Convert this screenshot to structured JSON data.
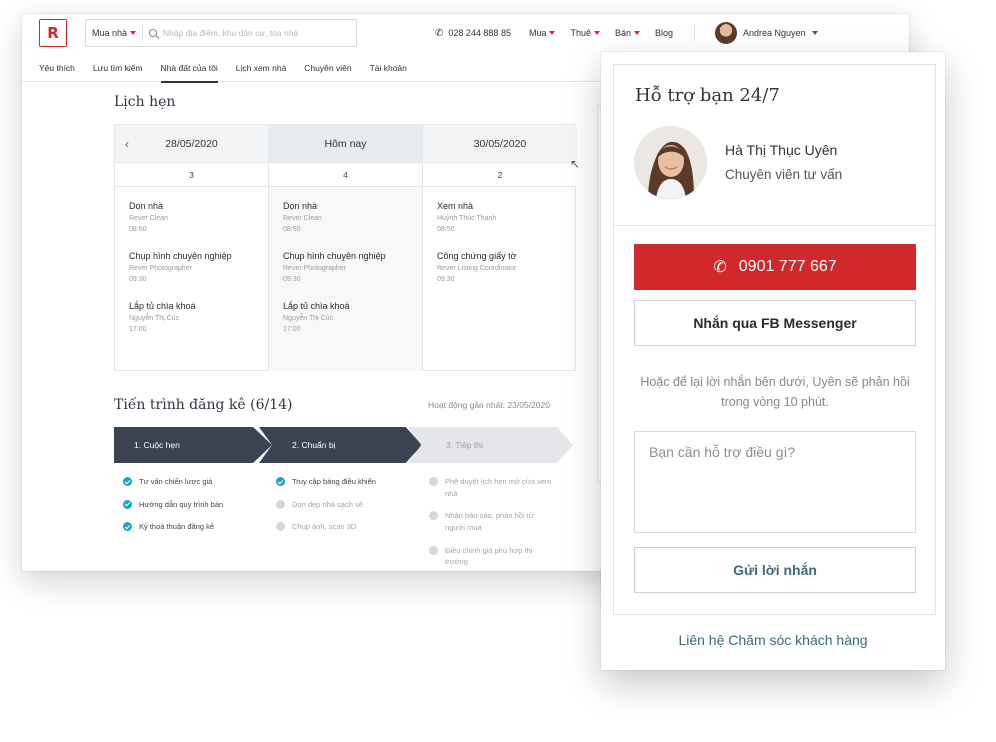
{
  "header": {
    "logo_letter": "R",
    "search_mode": "Mua nhà",
    "search_placeholder": "Nhập địa điểm, khu dân cư, tòa nhà",
    "phone": "028 244 888 85",
    "menus": [
      "Mua",
      "Thuê",
      "Bán"
    ],
    "blog": "Blog",
    "user_name": "Andrea Nguyen"
  },
  "tabs": [
    "Yêu thích",
    "Lưu tìm kiếm",
    "Nhà đất của tôi",
    "Lịch xem nhà",
    "Chuyên viên",
    "Tài khoản"
  ],
  "active_tab": "Nhà đất của tôi",
  "schedule": {
    "title": "Lịch hẹn",
    "days": [
      {
        "label": "28/05/2020",
        "count": "3",
        "items": [
          {
            "title": "Dọn nhà",
            "who": "Rever Clean",
            "time": "08:50"
          },
          {
            "title": "Chụp hình chuyên nghiệp",
            "who": "Rever Photographer",
            "time": "09:30"
          },
          {
            "title": "Lắp tủ chìa khoá",
            "who": "Nguyễn Thị Cúc",
            "time": "17:00"
          }
        ]
      },
      {
        "label": "Hôm nay",
        "count": "4",
        "items": [
          {
            "title": "Dọn nhà",
            "who": "Rever Clean",
            "time": "08:50"
          },
          {
            "title": "Chụp hình chuyên nghiệp",
            "who": "Rever Photographer",
            "time": "09:30"
          },
          {
            "title": "Lắp tủ chìa khoá",
            "who": "Nguyễn Thị Cúc",
            "time": "17:00"
          }
        ]
      },
      {
        "label": "30/05/2020",
        "count": "2",
        "items": [
          {
            "title": "Xem nhà",
            "who": "Huỳnh Thúc Thanh",
            "time": "08:50"
          },
          {
            "title": "Công chứng giấy tờ",
            "who": "Rever Listing Coordinator",
            "time": "09:30"
          }
        ]
      }
    ]
  },
  "progress": {
    "title": "Tiến trình đăng kê (6/14)",
    "last_activity": "Hoạt động gần nhất: 23/05/2020",
    "steps": [
      "1. Cuộc hẹn",
      "2. Chuẩn bị",
      "3. Tiếp thị"
    ],
    "col1": [
      {
        "text": "Tư vấn chiến lược giá",
        "done": true
      },
      {
        "text": "Hướng dẫn quy trình bán",
        "done": true
      },
      {
        "text": "Ký thoả thuận đăng kê",
        "done": true
      }
    ],
    "col2": [
      {
        "text": "Truy cập bảng điều khiển",
        "done": true
      },
      {
        "text": "Dọn dẹp nhà sạch sẽ",
        "done": false
      },
      {
        "text": "Chụp ảnh, scan 3D",
        "done": false
      }
    ],
    "col3": [
      {
        "text": "Phê duyệt lịch hẹn mở cửa xem nhà",
        "done": false
      },
      {
        "text": "Nhận báo cáo, phản hồi từ người mua",
        "done": false
      },
      {
        "text": "Điều chỉnh giá phù hợp thị trường",
        "done": false
      }
    ]
  },
  "support": {
    "title": "Hỗ trợ bạn 24/7",
    "agent_name": "Hà Thị Thục Uyên",
    "agent_role": "Chuyên viên tư vấn",
    "call_number": "0901 777 667",
    "fb_button": "Nhắn qua FB Messenger",
    "note": "Hoặc để lại lời nhắn bên dưới, Uyên sẽ phản hồi trong vòng 10 phút.",
    "message_placeholder": "Bạn cần hỗ trợ điều gì?",
    "send_button": "Gửi lời nhắn",
    "cs_link": "Liên hệ Chăm sóc khách hàng"
  },
  "colors": {
    "accent": "#d0282b",
    "step_active": "#3a4350",
    "check": "#1aa3c5",
    "link": "#3b6a78"
  }
}
